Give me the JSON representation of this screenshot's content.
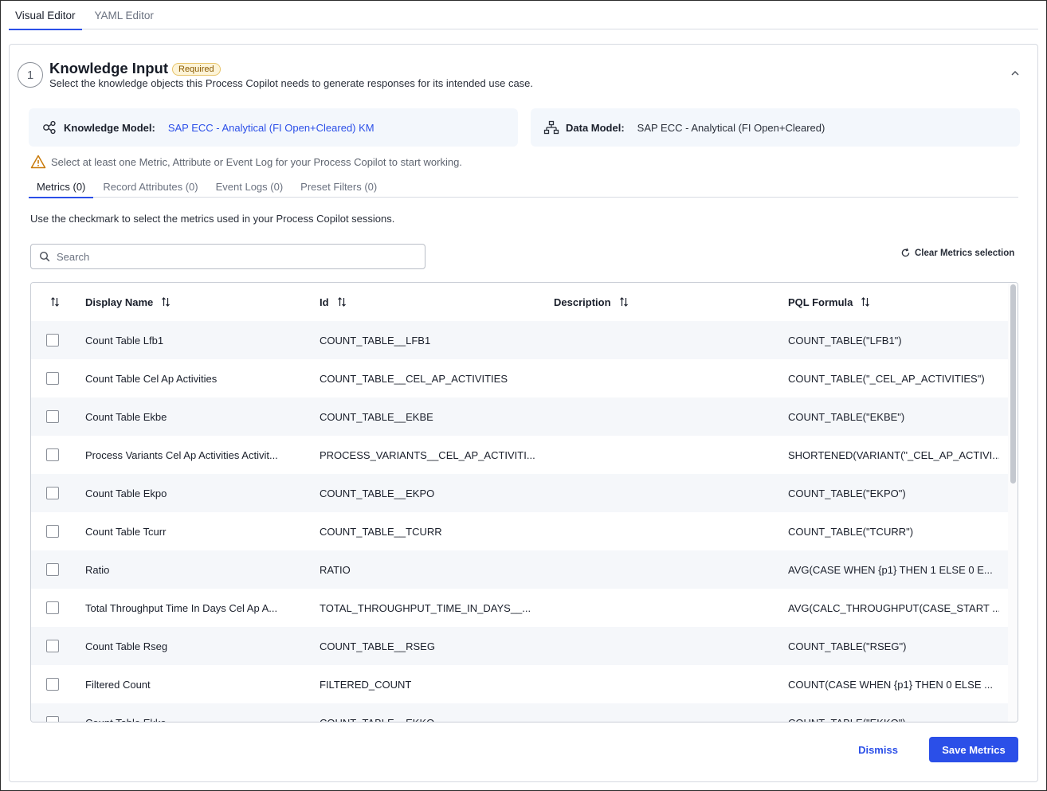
{
  "top_tabs": [
    {
      "label": "Visual Editor",
      "active": true
    },
    {
      "label": "YAML Editor",
      "active": false
    }
  ],
  "section": {
    "step": "1",
    "title": "Knowledge Input",
    "badge": "Required",
    "subtitle": "Select the knowledge objects this Process Copilot needs to generate responses for its intended use case."
  },
  "knowledge_model": {
    "label": "Knowledge Model:",
    "value": "SAP ECC - Analytical (FI Open+Cleared) KM"
  },
  "data_model": {
    "label": "Data Model:",
    "value": "SAP ECC - Analytical (FI Open+Cleared)"
  },
  "warning": "Select at least one Metric, Attribute or Event Log for your Process Copilot to start working.",
  "inner_tabs": [
    {
      "label": "Metrics (0)",
      "active": true
    },
    {
      "label": "Record Attributes (0)",
      "active": false
    },
    {
      "label": "Event Logs (0)",
      "active": false
    },
    {
      "label": "Preset Filters (0)",
      "active": false
    }
  ],
  "instructions": "Use the checkmark to select the metrics used in your Process Copilot sessions.",
  "search": {
    "placeholder": "Search",
    "value": ""
  },
  "clear_label": "Clear Metrics selection",
  "table": {
    "columns": [
      "Display Name",
      "Id",
      "Description",
      "PQL Formula"
    ],
    "rows": [
      {
        "name": "Count Table Lfb1",
        "id": "COUNT_TABLE__LFB1",
        "description": "",
        "pql": "COUNT_TABLE(\"LFB1\")"
      },
      {
        "name": "Count Table Cel Ap Activities",
        "id": "COUNT_TABLE__CEL_AP_ACTIVITIES",
        "description": "",
        "pql": "COUNT_TABLE(\"_CEL_AP_ACTIVITIES\")"
      },
      {
        "name": "Count Table Ekbe",
        "id": "COUNT_TABLE__EKBE",
        "description": "",
        "pql": "COUNT_TABLE(\"EKBE\")"
      },
      {
        "name": "Process Variants Cel Ap Activities Activit...",
        "id": "PROCESS_VARIANTS__CEL_AP_ACTIVITI...",
        "description": "",
        "pql": "SHORTENED(VARIANT(\"_CEL_AP_ACTIVI..."
      },
      {
        "name": "Count Table Ekpo",
        "id": "COUNT_TABLE__EKPO",
        "description": "",
        "pql": "COUNT_TABLE(\"EKPO\")"
      },
      {
        "name": "Count Table Tcurr",
        "id": "COUNT_TABLE__TCURR",
        "description": "",
        "pql": "COUNT_TABLE(\"TCURR\")"
      },
      {
        "name": "Ratio",
        "id": "RATIO",
        "description": "",
        "pql": "AVG(CASE WHEN {p1} THEN 1 ELSE 0 E..."
      },
      {
        "name": "Total Throughput Time In Days Cel Ap A...",
        "id": "TOTAL_THROUGHPUT_TIME_IN_DAYS__...",
        "description": "",
        "pql": "AVG(CALC_THROUGHPUT(CASE_START ..."
      },
      {
        "name": "Count Table Rseg",
        "id": "COUNT_TABLE__RSEG",
        "description": "",
        "pql": "COUNT_TABLE(\"RSEG\")"
      },
      {
        "name": "Filtered Count",
        "id": "FILTERED_COUNT",
        "description": "",
        "pql": "COUNT(CASE WHEN {p1} THEN 0 ELSE ..."
      },
      {
        "name": "Count Table Ekko",
        "id": "COUNT_TABLE__EKKO",
        "description": "",
        "pql": "COUNT_TABLE(\"EKKO\")"
      }
    ]
  },
  "buttons": {
    "dismiss": "Dismiss",
    "save": "Save Metrics"
  },
  "colors": {
    "accent": "#2b4fe8",
    "badge_bg": "#fdf4d8",
    "badge_border": "#e7c46a",
    "model_box_bg": "#f3f7fc",
    "row_alt_bg": "#f5f7fa"
  }
}
